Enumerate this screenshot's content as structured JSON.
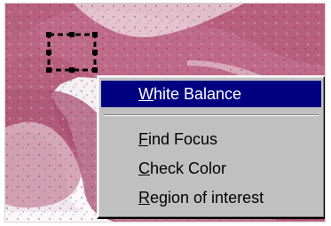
{
  "context_menu": {
    "items": [
      {
        "label": "White Balance",
        "mnemonic": "W",
        "rest": "hite Balance",
        "selected": true
      },
      {
        "label": "Find Focus",
        "mnemonic": "F",
        "rest": "ind Focus",
        "selected": false
      },
      {
        "label": "Check Color",
        "mnemonic": "C",
        "rest": "heck Color",
        "selected": false
      },
      {
        "label": "Region of interest",
        "mnemonic": "R",
        "rest": "egion of interest",
        "selected": false
      }
    ]
  },
  "colors": {
    "menu_background": "#c0c0c0",
    "selection_background": "#000080",
    "selection_text": "#ffffff",
    "menu_text": "#000000",
    "tissue_pink": "#b8607e",
    "tissue_light": "#e9dfe3"
  },
  "icons": {
    "region_selector": "dashed-rectangle-icon"
  }
}
